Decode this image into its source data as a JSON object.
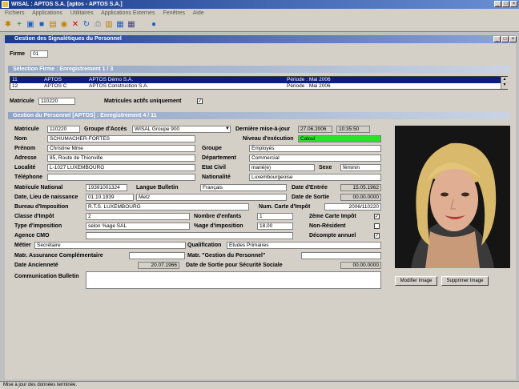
{
  "app": {
    "title": "WISAL : APTOS S.A. [aptos - APTOS S.A.]",
    "menu": [
      "Fichiers",
      "Applications",
      "Utilitaires",
      "Applications Externes",
      "Fenêtres",
      "Aide"
    ]
  },
  "window": {
    "title": "Gestion des Signalétiques du Personnel",
    "firme_label": "Firme",
    "firme_value": "01"
  },
  "selection": {
    "header": "Sélection Firme : Enregistrement 1 / 3",
    "rows": [
      {
        "id": "11",
        "code": "APTOS",
        "name": "APTOS Démo S.A.",
        "period": "Période : Mai 2006"
      },
      {
        "id": "12",
        "code": "APTOS C",
        "name": "APTOS Construction S.A.",
        "period": "Période : Mai 2006"
      }
    ],
    "matricule_label": "Matricule",
    "matricule_value": "110220",
    "actifs_label": "Matricules actifs uniquement",
    "actifs_checked": "✓"
  },
  "personnel": {
    "header": "Gestion du Personnel [APTOS] : Enregistrement 4 / 11",
    "matricule": {
      "label": "Matricule",
      "value": "110220"
    },
    "groupe_acces": {
      "label": "Groupe d'Accès",
      "value": "WISAL Groupe 900"
    },
    "derniere_maj": {
      "label": "Dernière mise-à-jour",
      "date": "27.06.2006",
      "time": "10:35:50"
    },
    "niveau": {
      "label": "Niveau d'exécution",
      "value": "Calcul"
    },
    "nom": {
      "label": "Nom",
      "value": "SCHUMACHER-FORTES"
    },
    "prenom": {
      "label": "Prénom",
      "value": "Christine Mme"
    },
    "groupe": {
      "label": "Groupe",
      "value": "Employés"
    },
    "adresse": {
      "label": "Adresse",
      "value": "85, Route de Thionville"
    },
    "departement": {
      "label": "Département",
      "value": "Commercial"
    },
    "localite": {
      "label": "Localité",
      "value": "L-1027 LUXEMBOURG"
    },
    "etat_civil": {
      "label": "Etat Civil",
      "value": "marié(e)"
    },
    "sexe": {
      "label": "Sexe",
      "value": "féminin"
    },
    "telephone": {
      "label": "Téléphone",
      "value": ""
    },
    "nationalite": {
      "label": "Nationalité",
      "value": "Luxembourgeoise"
    },
    "matricule_national": {
      "label": "Matricule National",
      "value": "19391001324"
    },
    "langue_bulletin": {
      "label": "Langue Bulletin",
      "value": "Français"
    },
    "date_entree": {
      "label": "Date d'Entrée",
      "value": "15.05.1962"
    },
    "naissance": {
      "label": "Date, Lieu de naissance",
      "date": "01.10.1939",
      "lieu": "Metz"
    },
    "date_sortie": {
      "label": "Date de Sortie",
      "value": "00.00.0000"
    },
    "bureau": {
      "label": "Bureau d'Imposition",
      "value": "R.T.S. LUXEMBOURG"
    },
    "num_carte": {
      "label": "Num. Carte d'Impôt",
      "value": "2006/110220"
    },
    "classe": {
      "label": "Classe d'Impôt",
      "value": "2"
    },
    "enfants": {
      "label": "Nombre d'enfants",
      "value": "1"
    },
    "carte2": {
      "label": "2ème Carte Impôt",
      "checked": "✓"
    },
    "type_imposition": {
      "label": "Type d'imposition",
      "value": "selon %age SAL"
    },
    "pct_imposition": {
      "label": "%age d'imposition",
      "value": "18,00"
    },
    "non_resident": {
      "label": "Non-Résident",
      "checked": ""
    },
    "agence_cmo": {
      "label": "Agence CMO",
      "value": ""
    },
    "decompte": {
      "label": "Décompte annuel",
      "checked": "✓"
    },
    "metier": {
      "label": "Métier",
      "value": "Secrétaire"
    },
    "qualification": {
      "label": "Qualification",
      "value": "Etudes Primaires"
    },
    "assurance": {
      "label": "Matr. Assurance Complémentaire",
      "value": ""
    },
    "gestion_perso": {
      "label": "Matr. \"Gestion du Personnel\"",
      "value": ""
    },
    "anciennete": {
      "label": "Date Ancienneté",
      "value": "20.07.1966"
    },
    "sortie_secu": {
      "label": "Date de Sortie pour Sécurité Sociale",
      "value": "00.00.0000"
    },
    "communication": {
      "label": "Communication Bulletin",
      "value": ""
    },
    "btn_modifier": "Modifier Image",
    "btn_supprimer": "Supprimer Image"
  },
  "status": "Mise à jour des données terminée.",
  "colors": {
    "title": "#1a3c8c",
    "niveau_bg": "#2ee02e",
    "selected_row": "#0a1f7a"
  }
}
